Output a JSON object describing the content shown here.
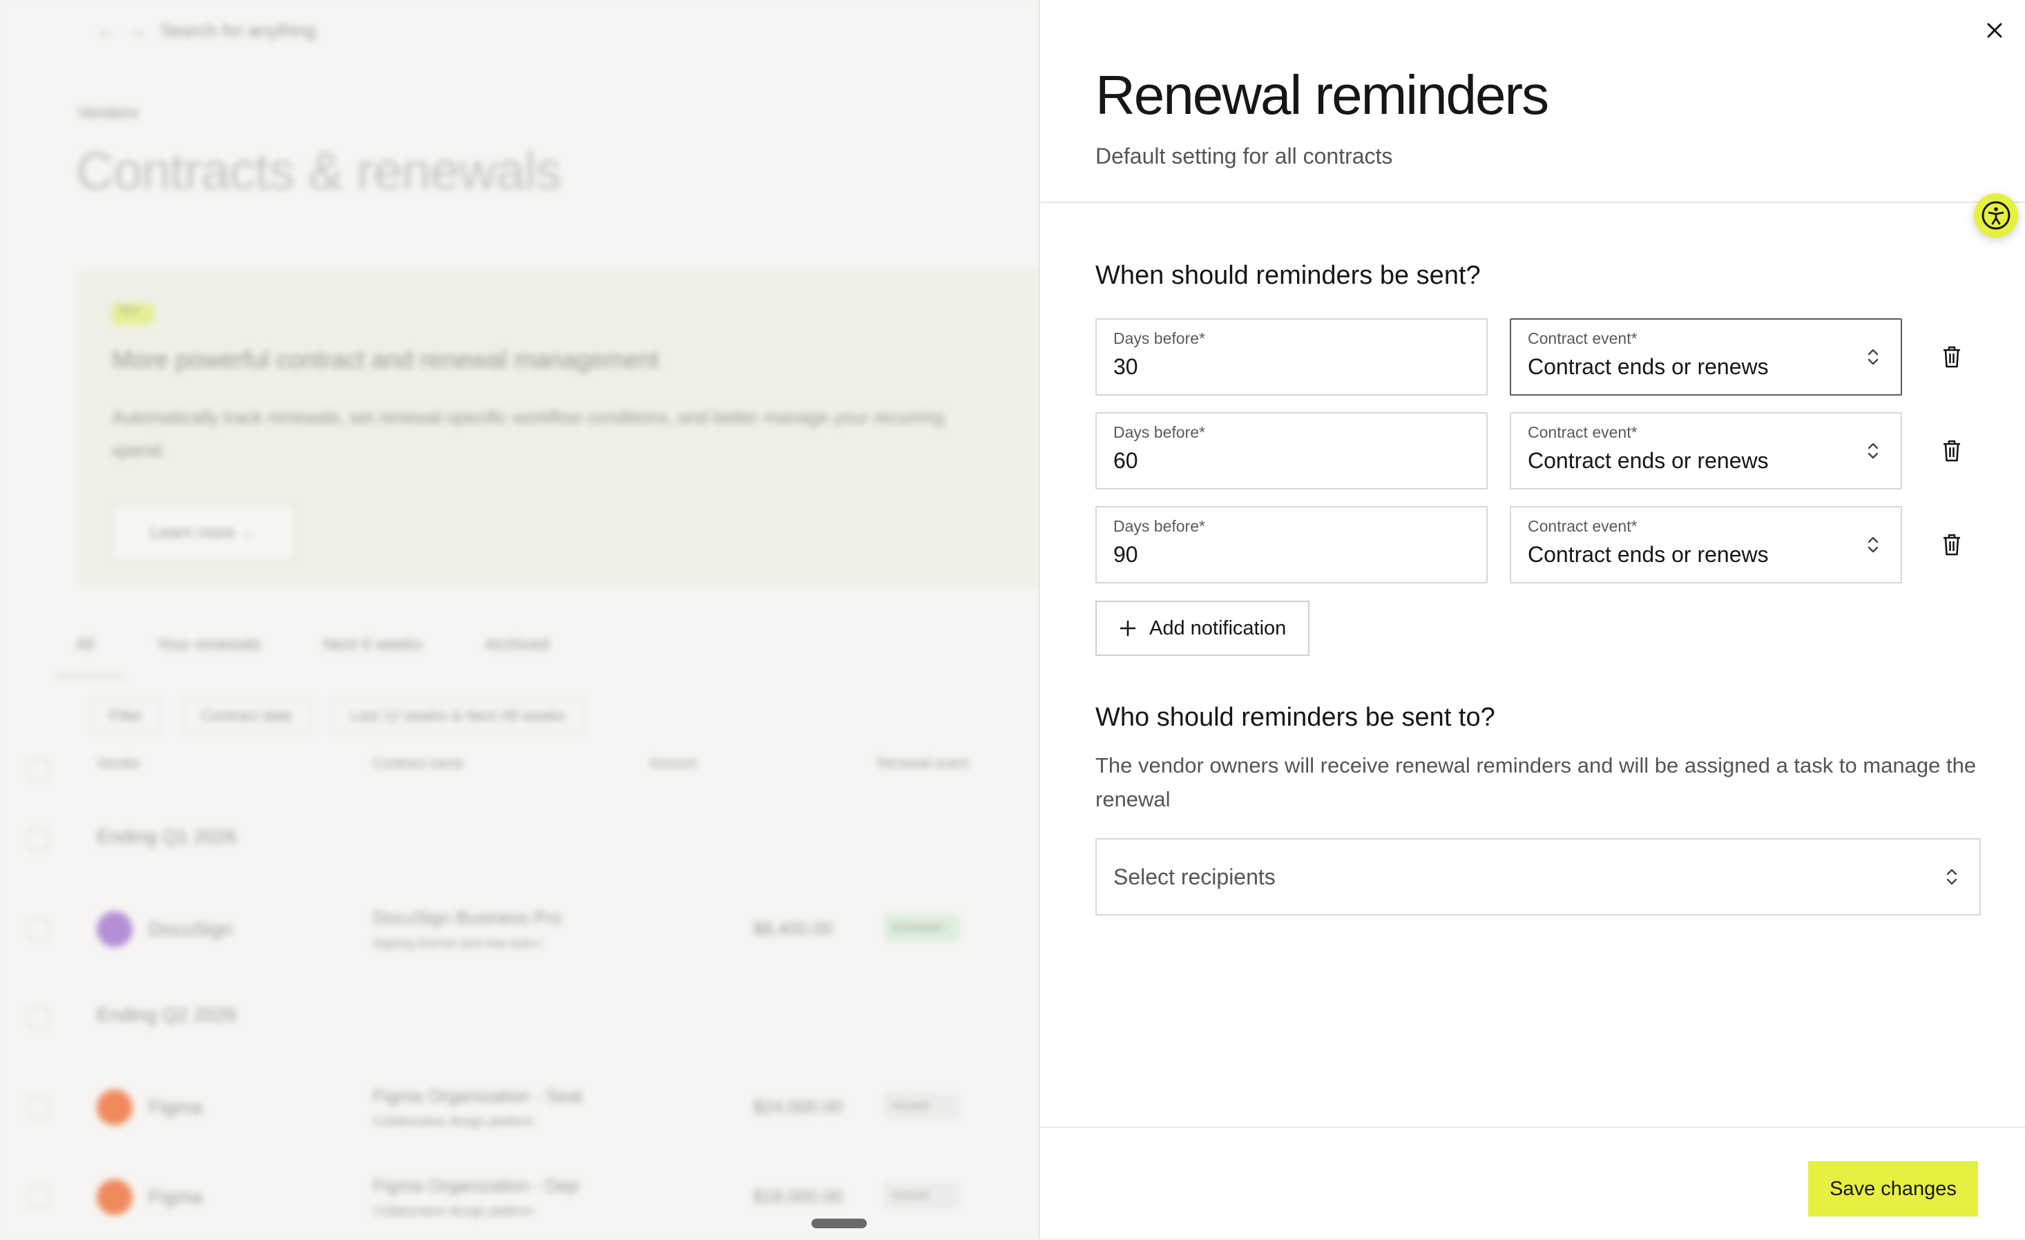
{
  "background": {
    "search_placeholder": "Search for anything",
    "breadcrumb": "Vendors",
    "page_title": "Contracts & renewals",
    "promo": {
      "tag": "New",
      "headline": "More powerful contract and renewal management",
      "description": "Automatically track renewals, set renewal-specific workflow conditions, and better manage your recurring spend.",
      "cta": "Learn more"
    },
    "tabs": [
      "All",
      "Your renewals",
      "Next 6 weeks",
      "Archived"
    ],
    "filters": [
      "Filter",
      "Contract date",
      "Last 12 weeks & Next 48 weeks"
    ],
    "columns": [
      "Vendor",
      "Contract name",
      "Amount",
      "Renewal event"
    ],
    "groups": [
      "Ending Q1 2026",
      "Ending Q2 2026"
    ],
    "rows": [
      {
        "vendor": "DocuSign",
        "plan": "DocuSign Business Pro",
        "plan_sub": "Signing license and new auto-r",
        "amount": "$8,400.00",
        "status": "Scheduled",
        "logo_color": "#b58fd6",
        "badge_color": "#dfeedd"
      },
      {
        "vendor": "Figma",
        "plan": "Figma Organization - Seat",
        "plan_sub": "Collaborative design platform",
        "amount": "$24,000.00",
        "status": "Unused",
        "logo_color": "#f08a5d",
        "badge_color": "#ececea"
      },
      {
        "vendor": "Figma",
        "plan": "Figma Organization - Dep",
        "plan_sub": "Collaborative design platform",
        "amount": "$18,000.00",
        "status": "Unused",
        "logo_color": "#f08a5d",
        "badge_color": "#ececea"
      }
    ]
  },
  "drawer": {
    "title": "Renewal reminders",
    "subtitle": "Default setting for all contracts",
    "when_title": "When should reminders be sent?",
    "reminders": [
      {
        "days_label": "Days before*",
        "days_value": "30",
        "event_label": "Contract event*",
        "event_value": "Contract ends or renews"
      },
      {
        "days_label": "Days before*",
        "days_value": "60",
        "event_label": "Contract event*",
        "event_value": "Contract ends or renews"
      },
      {
        "days_label": "Days before*",
        "days_value": "90",
        "event_label": "Contract event*",
        "event_value": "Contract ends or renews"
      }
    ],
    "add_notification_label": "Add notification",
    "who_title": "Who should reminders be sent to?",
    "who_help": "The vendor owners will receive renewal reminders and will be assigned a task to manage the renewal",
    "recipients_placeholder": "Select recipients",
    "save_label": "Save changes"
  },
  "icons": {
    "close": "close-icon",
    "accessibility": "accessibility-icon",
    "chevrons": "chevron-up-down-icon",
    "trash": "trash-icon",
    "plus": "plus-icon"
  },
  "colors": {
    "accent": "#e6f040",
    "text": "#161616",
    "muted": "#555553",
    "border": "#d7d7d4"
  }
}
